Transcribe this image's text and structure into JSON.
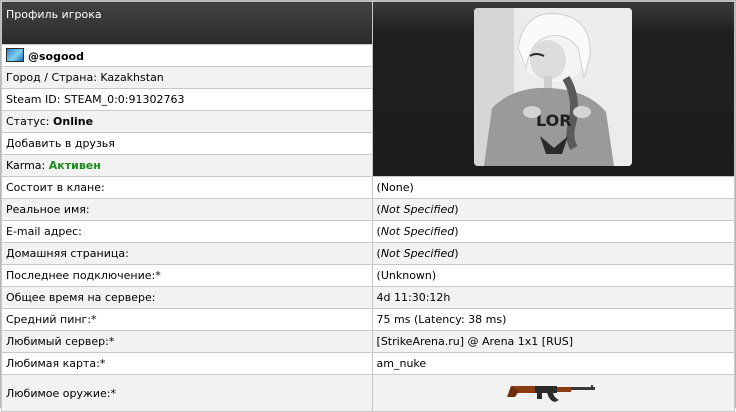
{
  "header": {
    "title": "Профиль игрока"
  },
  "player": {
    "name": "@sogood",
    "city_label": "Город / Страна:",
    "city_value": "Kazakhstan",
    "steam_label": "Steam ID:",
    "steam_value": "STEAM_0:0:91302763",
    "status_label": "Статус:",
    "status_value": "Online",
    "add_friend": "Добавить в друзья",
    "karma_label": "Karma:",
    "karma_value": "Активен"
  },
  "details": [
    {
      "label": "Состоит в клане:",
      "value": "(None)",
      "italic": false
    },
    {
      "label": "Реальное имя:",
      "value": "Not Specified",
      "italic": true
    },
    {
      "label": "E-mail адрес:",
      "value": "Not Specified",
      "italic": true
    },
    {
      "label": "Домашняя страница:",
      "value": "Not Specified",
      "italic": true
    },
    {
      "label": "Последнее подключение:*",
      "value": "(Unknown)",
      "italic": false
    },
    {
      "label": "Общее время на сервере:",
      "value": "4d 11:30:12h",
      "italic": false
    },
    {
      "label": "Средний пинг:*",
      "value": "75 ms (Latency: 38 ms)",
      "italic": false
    },
    {
      "label": "Любимый сервер:*",
      "value": "[StrikeArena.ru] @ Arena 1x1 [RUS]",
      "italic": false
    },
    {
      "label": "Любимая карта:*",
      "value": "am_nuke",
      "italic": false
    }
  ],
  "weapon": {
    "label": "Любимое оружие:*",
    "icon": "ak47-rifle-icon"
  },
  "colors": {
    "header_bg": "#2b2b2b",
    "alt_row": "#f2f2f2",
    "online_green": "#1c8b1c",
    "flag_blue": "#2d7ec9"
  }
}
